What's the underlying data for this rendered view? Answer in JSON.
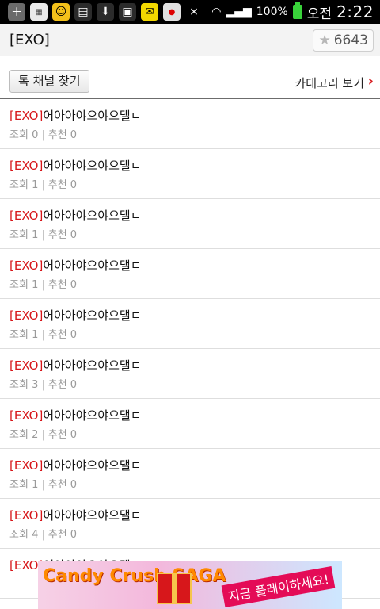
{
  "status_bar": {
    "battery": "100%",
    "ampm": "오전",
    "time": "2:22",
    "icons": [
      "plus-icon",
      "app-icon",
      "kakao-icon",
      "calendar-icon",
      "download-icon",
      "gallery-icon",
      "talk-icon",
      "daum-icon",
      "mute-icon",
      "wifi-icon",
      "signal-icon",
      "battery-icon"
    ]
  },
  "header": {
    "title": "[EXO]",
    "star_count": "6643"
  },
  "toolbar": {
    "find_channel_label": "톡 채널 찾기",
    "category_label": "카테고리 보기"
  },
  "list": [
    {
      "tag": "[EXO]",
      "title": "어아아야으야으댈ㄷ",
      "views_label": "조회",
      "views": "0",
      "recs_label": "추천",
      "recs": "0"
    },
    {
      "tag": "[EXO]",
      "title": "어아아야으야으댈ㄷ",
      "views_label": "조회",
      "views": "1",
      "recs_label": "추천",
      "recs": "0"
    },
    {
      "tag": "[EXO]",
      "title": "어아아야으야으댈ㄷ",
      "views_label": "조회",
      "views": "1",
      "recs_label": "추천",
      "recs": "0"
    },
    {
      "tag": "[EXO]",
      "title": "어아아야으야으댈ㄷ",
      "views_label": "조회",
      "views": "1",
      "recs_label": "추천",
      "recs": "0"
    },
    {
      "tag": "[EXO]",
      "title": "어아아야으야으댈ㄷ",
      "views_label": "조회",
      "views": "1",
      "recs_label": "추천",
      "recs": "0"
    },
    {
      "tag": "[EXO]",
      "title": "어아아야으야으댈ㄷ",
      "views_label": "조회",
      "views": "3",
      "recs_label": "추천",
      "recs": "0"
    },
    {
      "tag": "[EXO]",
      "title": "어아아야으야으댈ㄷ",
      "views_label": "조회",
      "views": "2",
      "recs_label": "추천",
      "recs": "0"
    },
    {
      "tag": "[EXO]",
      "title": "어아아야으야으댈ㄷ",
      "views_label": "조회",
      "views": "1",
      "recs_label": "추천",
      "recs": "0"
    },
    {
      "tag": "[EXO]",
      "title": "어아아야으야으댈ㄷ",
      "views_label": "조회",
      "views": "4",
      "recs_label": "추천",
      "recs": "0"
    },
    {
      "tag": "[EXO]",
      "title": "어아아야으야으댈ㄷ",
      "views_label": "조회",
      "views": "",
      "recs_label": "",
      "recs": ""
    }
  ],
  "ad": {
    "brand": "Candy Crush SAGA",
    "cta": "지금 플레이하세요!"
  },
  "colors": {
    "accent_red": "#d7171b",
    "meta_gray": "#9a9a9a"
  }
}
